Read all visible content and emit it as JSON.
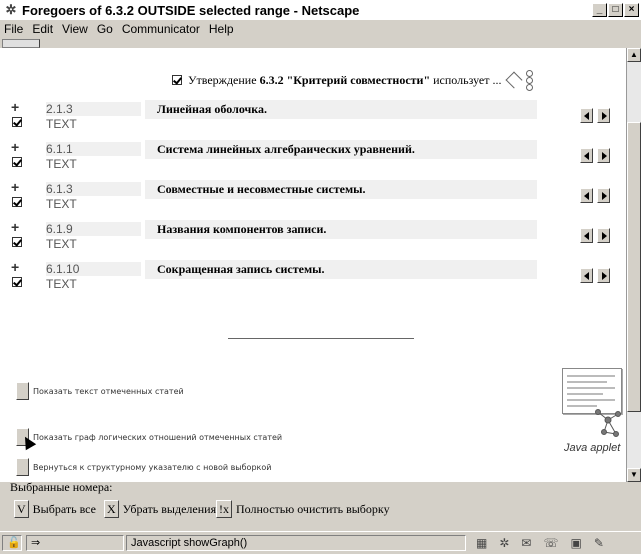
{
  "window": {
    "title": "Foregoers of 6.3.2 OUTSIDE selected range - Netscape",
    "buttons": [
      "_",
      "□",
      "×"
    ]
  },
  "menu": [
    {
      "label": "File",
      "accel": "F"
    },
    {
      "label": "Edit",
      "accel": "E"
    },
    {
      "label": "View",
      "accel": "V"
    },
    {
      "label": "Go",
      "accel": "G"
    },
    {
      "label": "Communicator",
      "accel": "C"
    },
    {
      "label": "Help",
      "accel": "H"
    }
  ],
  "header": {
    "prefix": "Утверждение",
    "bold": "6.3.2 \"Критерий совместности\"",
    "suffix": "использует ..."
  },
  "rows": [
    {
      "code": "2.1.3",
      "kind": "TEXT",
      "title": "Линейная оболочка."
    },
    {
      "code": "6.1.1",
      "kind": "TEXT",
      "title": "Система линейных алгебраических уравнений."
    },
    {
      "code": "6.1.3",
      "kind": "TEXT",
      "title": "Совместные и несовместные системы."
    },
    {
      "code": "6.1.9",
      "kind": "TEXT",
      "title": "Названия компонентов записи."
    },
    {
      "code": "6.1.10",
      "kind": "TEXT",
      "title": "Сокращенная запись системы."
    }
  ],
  "actions": [
    "Показать текст отмеченных статей",
    "Показать граф логических отношений отмеченных статей",
    "Вернуться к структурному указателю с новой выборкой"
  ],
  "applet_label": "Java applet",
  "selected_label": "Выбранные номера:",
  "selection_buttons": [
    {
      "key": "V",
      "label": "Выбрать все"
    },
    {
      "key": "X",
      "label": "Убрать выделения"
    },
    {
      "key": "!x",
      "label": "Полностью очистить выборку"
    }
  ],
  "status": {
    "text": "Javascript showGraph()"
  }
}
